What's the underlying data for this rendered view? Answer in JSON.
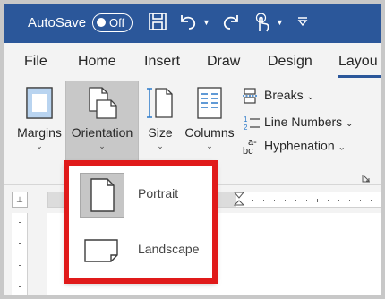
{
  "titlebar": {
    "autosave_label": "AutoSave",
    "autosave_state": "Off",
    "icons": [
      "save-icon",
      "undo-icon",
      "redo-icon",
      "touch-mode-icon",
      "customize-quick-access-icon"
    ]
  },
  "tabs": [
    {
      "label": "File"
    },
    {
      "label": "Home"
    },
    {
      "label": "Insert"
    },
    {
      "label": "Draw"
    },
    {
      "label": "Design"
    },
    {
      "label": "Layout",
      "visible_text": "Layou"
    }
  ],
  "ribbon": {
    "margins_label": "Margins",
    "orientation_label": "Orientation",
    "size_label": "Size",
    "columns_label": "Columns",
    "breaks_label": "Breaks",
    "line_numbers_label": "Line Numbers",
    "hyphenation_label": "Hyphenation",
    "hyphenation_icon_top": "a-",
    "hyphenation_icon_bottom": "bc"
  },
  "ruler": {
    "tab_selector": "⊥"
  },
  "orientation_menu": {
    "options": [
      {
        "label": "Portrait",
        "icon": "portrait-page-icon",
        "selected": true
      },
      {
        "label": "Landscape",
        "icon": "landscape-page-icon",
        "selected": false
      }
    ]
  },
  "colors": {
    "title_bar": "#2b579a",
    "ribbon_bg": "#f3f3f3",
    "highlight_border": "#e01a1a",
    "selected_option": "#c6c6c6"
  }
}
